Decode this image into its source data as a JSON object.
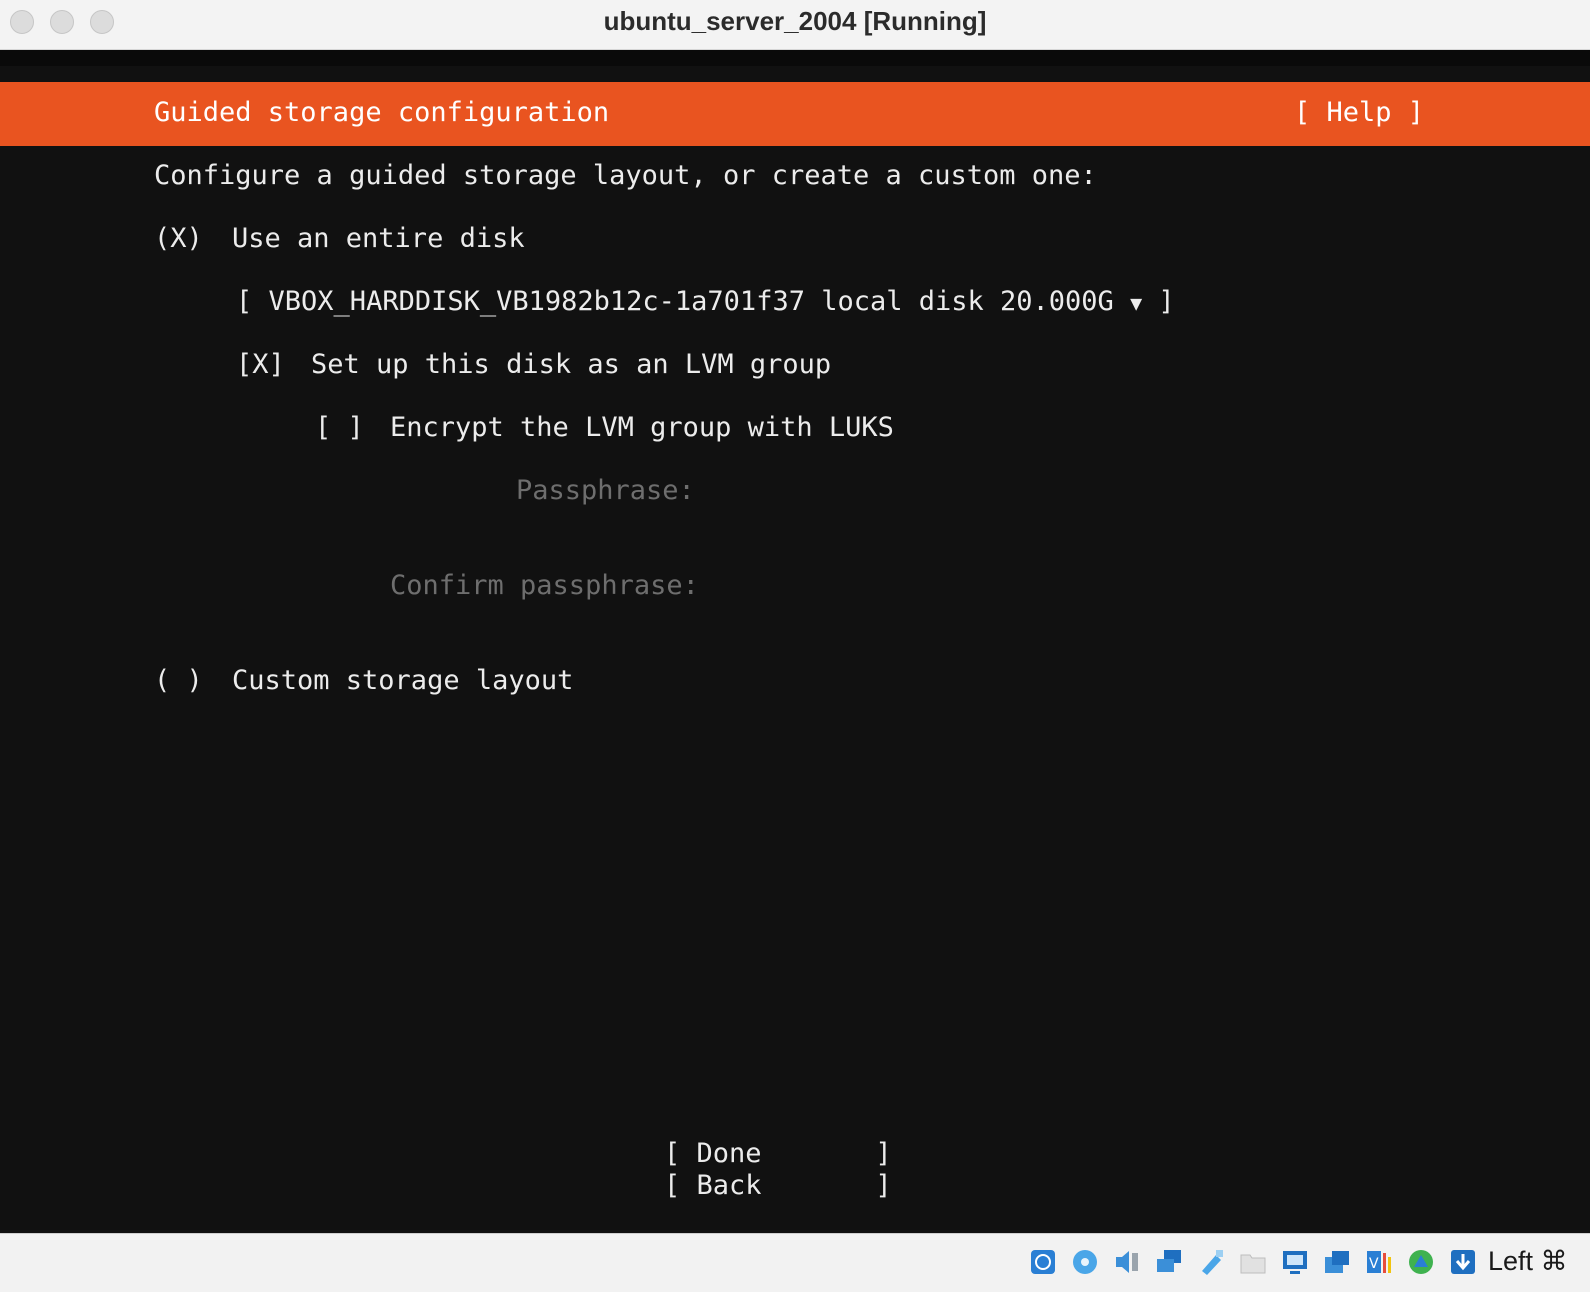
{
  "window": {
    "title": "ubuntu_server_2004 [Running]"
  },
  "header": {
    "title": "Guided storage configuration",
    "help": "[ Help ]"
  },
  "content": {
    "intro": "Configure a guided storage layout, or create a custom one:",
    "entire_disk": {
      "marker": "(X)",
      "label": "Use an entire disk",
      "selected": true
    },
    "disk_select": {
      "open": "[",
      "value": "VBOX_HARDDISK_VB1982b12c-1a701f37 local disk 20.000G",
      "arrow": "▼",
      "close": "]"
    },
    "lvm": {
      "marker": "[X]",
      "label": "Set up this disk as an LVM group",
      "checked": true
    },
    "luks": {
      "marker": "[ ]",
      "label": "Encrypt the LVM group with LUKS",
      "checked": false
    },
    "passphrase_label": "Passphrase:",
    "confirm_label": "Confirm passphrase:",
    "custom": {
      "marker": "( )",
      "label": "Custom storage layout",
      "selected": false
    }
  },
  "buttons": {
    "done": "[ Done       ]",
    "back": "[ Back       ]"
  },
  "statusbar": {
    "icons": [
      "hard-disk-icon",
      "optical-drive-icon",
      "audio-icon",
      "network-icon",
      "usb-icon",
      "shared-folders-icon",
      "display-icon",
      "recording-icon",
      "vrde-icon",
      "cpu-icon",
      "mouse-integration-icon"
    ],
    "host_key": "Left ⌘"
  },
  "colors": {
    "header": "#e95420",
    "screen": "#111111",
    "text": "#ececec",
    "dim": "#6e6e6e"
  }
}
